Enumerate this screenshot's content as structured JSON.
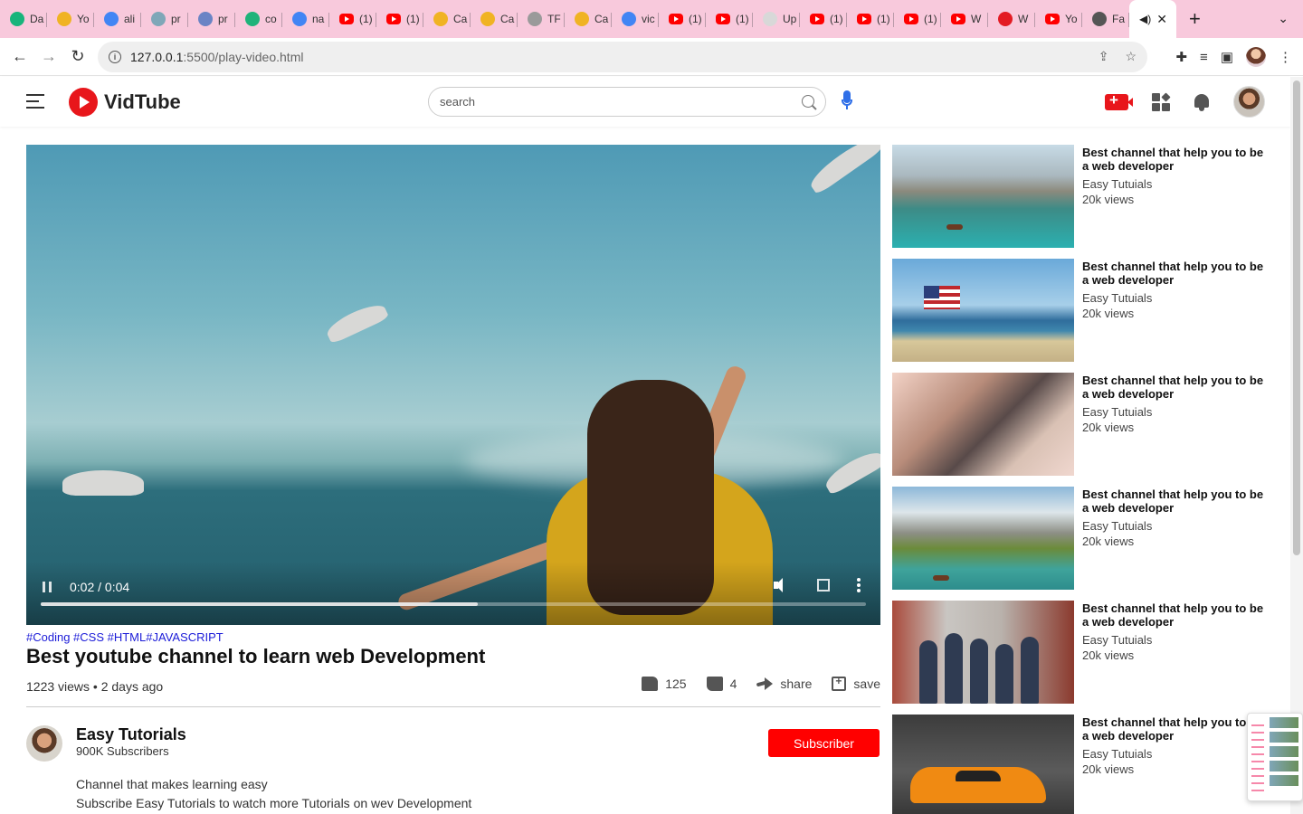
{
  "browser": {
    "tabs": [
      {
        "title": "Da",
        "icon": "shield-check-icon",
        "color": "#18b47b"
      },
      {
        "title": "Yo",
        "icon": "chrome-canary-icon",
        "color": "#f0b323"
      },
      {
        "title": "ali",
        "icon": "google-icon",
        "color": "#4285f4"
      },
      {
        "title": "pr",
        "icon": "pricing-icon",
        "color": "#7fa7b8"
      },
      {
        "title": "pr",
        "icon": "pricing-icon",
        "color": "#6a84c5"
      },
      {
        "title": "co",
        "icon": "codepen-icon",
        "color": "#1fb37a"
      },
      {
        "title": "na",
        "icon": "google-icon",
        "color": "#4285f4"
      },
      {
        "title": "(1)",
        "icon": "youtube-icon",
        "color": "#ff0000"
      },
      {
        "title": "(1)",
        "icon": "youtube-icon",
        "color": "#ff0000"
      },
      {
        "title": "Ca",
        "icon": "chrome-canary-icon",
        "color": "#f0b323"
      },
      {
        "title": "Ca",
        "icon": "chrome-canary-icon",
        "color": "#f0b323"
      },
      {
        "title": "TF",
        "icon": "globe-icon",
        "color": "#9a9a9a"
      },
      {
        "title": "Ca",
        "icon": "chrome-canary-icon",
        "color": "#f0b323"
      },
      {
        "title": "vic",
        "icon": "google-icon",
        "color": "#4285f4"
      },
      {
        "title": "(1)",
        "icon": "youtube-icon",
        "color": "#ff0000"
      },
      {
        "title": "(1)",
        "icon": "youtube-icon",
        "color": "#ff0000"
      },
      {
        "title": "Up",
        "icon": "github-icon",
        "color": "#d8d8d8"
      },
      {
        "title": "(1)",
        "icon": "youtube-icon",
        "color": "#ff0000"
      },
      {
        "title": "(1)",
        "icon": "youtube-icon",
        "color": "#ff0000"
      },
      {
        "title": "(1)",
        "icon": "youtube-icon",
        "color": "#ff0000"
      },
      {
        "title": "W",
        "icon": "youtube-icon",
        "color": "#ff0000"
      },
      {
        "title": "W",
        "icon": "w-icon",
        "color": "#e31b23"
      },
      {
        "title": "Yo",
        "icon": "youtube-icon",
        "color": "#ff0000"
      },
      {
        "title": "Fa",
        "icon": "globe-icon",
        "color": "#555555"
      }
    ],
    "new_tab_label": "+",
    "tab_menu_label": "⌄",
    "url_host": "127.0.0.1",
    "url_path": ":5500/play-video.html"
  },
  "header": {
    "brand": "VidTube",
    "search_placeholder": "search",
    "brand_color": "#e8161b"
  },
  "player": {
    "time": "0:02 / 0:04",
    "progress_fraction": 0.53
  },
  "video": {
    "tags": "#Coding #CSS #HTML#JAVASCRIPT",
    "title": "Best youtube channel to learn web Development",
    "meta": "1223 views • 2 days ago",
    "likes": "125",
    "dislikes": "4",
    "share_label": "share",
    "save_label": "save"
  },
  "channel": {
    "name": "Easy Tutorials",
    "subscribers": "900K Subscribers",
    "subscribe_label": "Subscriber",
    "description_line1": "Channel that makes learning easy",
    "description_line2": "Subscribe Easy Tutorials to watch more Tutorials on wev Development"
  },
  "sidebar": {
    "items": [
      {
        "title": "Best channel that help you to be a web developer",
        "channel": "Easy Tutuials",
        "views": "20k views"
      },
      {
        "title": "Best channel that help you to be a web developer",
        "channel": "Easy Tutuials",
        "views": "20k views"
      },
      {
        "title": "Best channel that help you to be a web developer",
        "channel": "Easy Tutuials",
        "views": "20k views"
      },
      {
        "title": "Best channel that help you to be a web developer",
        "channel": "Easy Tutuials",
        "views": "20k views"
      },
      {
        "title": "Best channel that help you to be a web developer",
        "channel": "Easy Tutuials",
        "views": "20k views"
      },
      {
        "title": "Best channel that help you to be a web developer",
        "channel": "Easy Tutuials",
        "views": "20k views"
      }
    ]
  }
}
